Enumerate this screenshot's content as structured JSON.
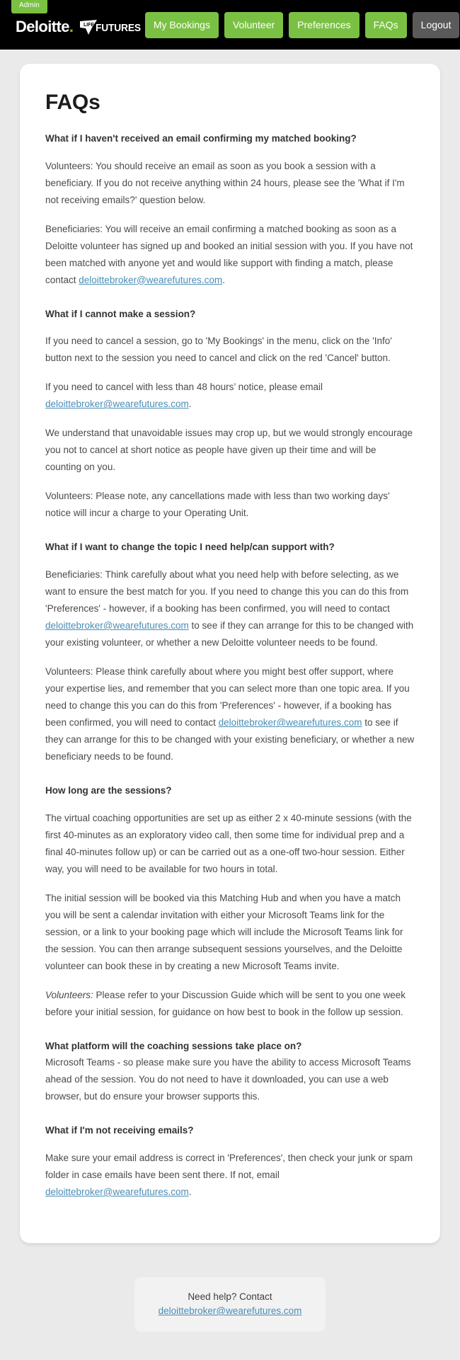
{
  "header": {
    "admin_badge": "Admin",
    "brand_primary": "Deloitte",
    "brand_dot": ".",
    "brand_secondary_top": "LIFE",
    "brand_secondary_small": "of",
    "brand_secondary": "FUTURES",
    "nav": [
      {
        "label": "My Bookings",
        "style": "green"
      },
      {
        "label": "Volunteer",
        "style": "green"
      },
      {
        "label": "Preferences",
        "style": "green"
      },
      {
        "label": "FAQs",
        "style": "green"
      },
      {
        "label": "Logout",
        "style": "grey"
      }
    ],
    "colors": {
      "bar": "#000000",
      "nav_green": "#7ac143",
      "nav_grey": "#5a5a5a",
      "brand_dot_green": "#86bc25"
    }
  },
  "main": {
    "title": "FAQs",
    "email": "deloittebroker@wearefutures.com",
    "faqs": [
      {
        "question": "What if I haven't received an email confirming my matched booking?",
        "answers": [
          {
            "text_before": "Volunteers: You should receive an email as soon as you book a session with a beneficiary. If you do not receive anything within 24 hours, please see the 'What if I'm not receiving emails?' question below.",
            "link": "",
            "text_after": ""
          },
          {
            "text_before": "Beneficiaries: You will receive an email confirming a matched booking as soon as a Deloitte volunteer has signed up and booked an initial session with you. If you have not been matched with anyone yet and would like support with finding a match, please contact ",
            "link": "deloittebroker@wearefutures.com",
            "text_after": "."
          }
        ]
      },
      {
        "question": "What if I cannot make a session?",
        "answers": [
          {
            "text_before": "If you need to cancel a session, go to 'My Bookings' in the menu, click on the 'Info' button next to the session you need to cancel and click on the red 'Cancel' button.",
            "link": "",
            "text_after": ""
          },
          {
            "text_before": "If you need to cancel with less than 48 hours’ notice, please email ",
            "link": "deloittebroker@wearefutures.com",
            "text_after": "."
          },
          {
            "text_before": "We understand that unavoidable issues may crop up, but we would strongly encourage you not to cancel at short notice as people have given up their time and will be counting on you.",
            "link": "",
            "text_after": ""
          },
          {
            "text_before": "Volunteers: Please note, any cancellations made with less than two working days' notice will incur a charge to your Operating Unit.",
            "link": "",
            "text_after": ""
          }
        ]
      },
      {
        "question": "What if I want to change the topic I need help/can support with?",
        "answers": [
          {
            "text_before": "Beneficiaries: Think carefully about what you need help with before selecting, as we want to ensure the best match for you. If you need to change this you can do this from 'Preferences' - however, if a booking has been confirmed, you will need to contact ",
            "link": "deloittebroker@wearefutures.com",
            "text_after": " to see if they can arrange for this to be changed with your existing volunteer, or whether a new Deloitte volunteer needs to be found."
          },
          {
            "text_before": "Volunteers: Please think carefully about where you might best offer support, where your expertise lies, and remember that you can select more than one topic area. If you need to change this you can do this from 'Preferences' - however, if a booking has been confirmed, you will need to contact ",
            "link": "deloittebroker@wearefutures.com",
            "text_after": " to see if they can arrange for this to be changed with your existing beneficiary, or whether a new beneficiary needs to be found."
          }
        ]
      },
      {
        "question": "How long are the sessions?",
        "answers": [
          {
            "text_before": "The virtual coaching opportunities are set up as either 2 x 40-minute sessions (with the first 40-minutes as an exploratory video call, then some time for individual prep and a final 40-minutes follow up) or can be carried out as a one-off two-hour session. Either way, you will need to be available for two hours in total.",
            "link": "",
            "text_after": ""
          },
          {
            "text_before": "The initial session will be booked via this Matching Hub and when you have a match you will be sent a calendar invitation with either your Microsoft Teams link for the session, or a link to your booking page which will include the Microsoft Teams link for the session. You can then arrange subsequent sessions yourselves, and the Deloitte volunteer can book these in by creating a new Microsoft Teams invite.",
            "link": "",
            "text_after": ""
          }
        ],
        "italic_lead": "Volunteers:",
        "italic_answer": " Please refer to your Discussion Guide which will be sent to you one week before your initial session, for guidance on how best to book in the follow up session."
      },
      {
        "question": "What platform will the coaching sessions take place on?",
        "answers": [
          {
            "text_before": "Microsoft Teams - so please make sure you have the ability to access Microsoft Teams ahead of the session. You do not need to have it downloaded, you can use a web browser, but do ensure your browser supports this.",
            "link": "",
            "text_after": ""
          }
        ]
      },
      {
        "question": "What if I'm not receiving emails?",
        "answers": [
          {
            "text_before": "Make sure your email address is correct in 'Preferences', then check your junk or spam folder in case emails have been sent there. If not, email ",
            "link": "deloittebroker@wearefutures.com",
            "text_after": "."
          }
        ]
      }
    ]
  },
  "footer": {
    "help_text": "Need help? Contact",
    "help_email": "deloittebroker@wearefutures.com"
  }
}
